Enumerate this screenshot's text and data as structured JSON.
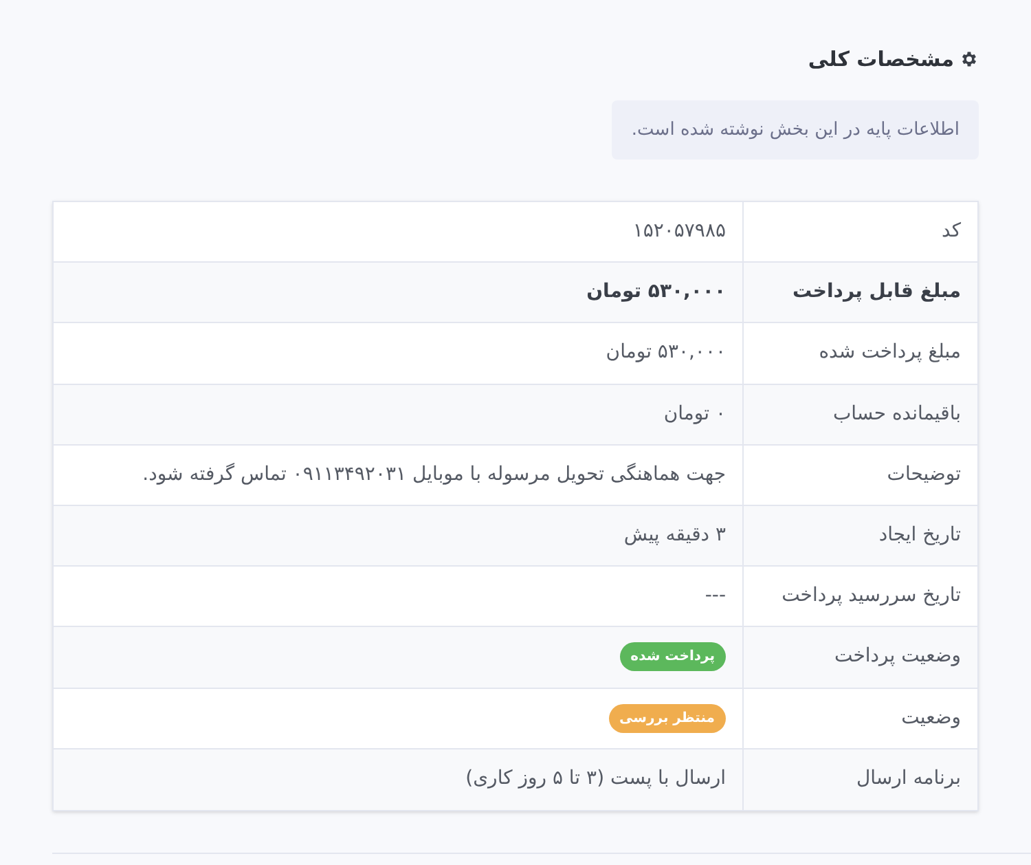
{
  "section": {
    "title": "مشخصات کلی",
    "note": "اطلاعات پایه در این بخش نوشته شده است."
  },
  "rows": [
    {
      "kind": "text",
      "label": "کد",
      "value": "۱۵۲۰۵۷۹۸۵",
      "bold": false
    },
    {
      "kind": "text",
      "label": "مبلغ قابل پرداخت",
      "value": "۵۳۰,۰۰۰ تومان",
      "bold": true
    },
    {
      "kind": "text",
      "label": "مبلغ پرداخت شده",
      "value": "۵۳۰,۰۰۰ تومان",
      "bold": false
    },
    {
      "kind": "text",
      "label": "باقیمانده حساب",
      "value": "۰ تومان",
      "bold": false
    },
    {
      "kind": "text",
      "label": "توضیحات",
      "value": "جهت هماهنگی تحویل مرسوله با موبایل ۰۹۱۱۳۴۹۲۰۳۱ تماس گرفته شود.",
      "bold": false
    },
    {
      "kind": "text",
      "label": "تاریخ ایجاد",
      "value": "۳ دقیقه پیش",
      "bold": false
    },
    {
      "kind": "text",
      "label": "تاریخ سررسید پرداخت",
      "value": "---",
      "bold": false
    },
    {
      "kind": "badge",
      "label": "وضعیت پرداخت",
      "value": "پرداخت شده",
      "color": "#5cb85c",
      "bold": false
    },
    {
      "kind": "badge",
      "label": "وضعیت",
      "value": "منتظر بررسی",
      "color": "#f0ad4e",
      "bold": false
    },
    {
      "kind": "text",
      "label": "برنامه ارسال",
      "value": "ارسال با پست (۳ تا ۵ روز کاری)",
      "bold": false
    }
  ]
}
